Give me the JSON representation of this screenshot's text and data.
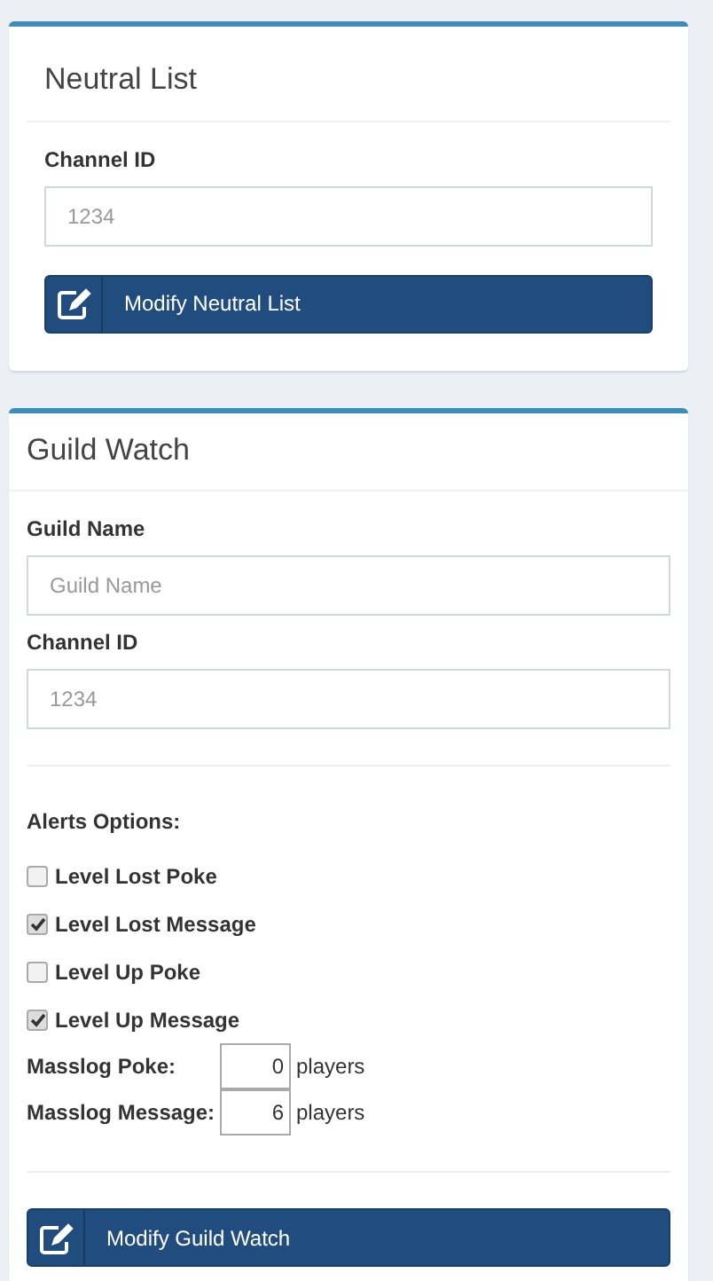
{
  "neutral_list": {
    "title": "Neutral List",
    "fields": [
      {
        "label": "Channel ID",
        "placeholder": "1234"
      }
    ],
    "button": "Modify Neutral List"
  },
  "guild_watch": {
    "title": "Guild Watch",
    "fields": [
      {
        "label": "Guild Name",
        "placeholder": "Guild Name"
      },
      {
        "label": "Channel ID",
        "placeholder": "1234"
      }
    ],
    "alerts_heading": "Alerts Options:",
    "options": [
      {
        "label": "Level Lost Poke",
        "checked": false
      },
      {
        "label": "Level Lost Message",
        "checked": true
      },
      {
        "label": "Level Up Poke",
        "checked": false
      },
      {
        "label": "Level Up Message",
        "checked": true
      }
    ],
    "thresholds": [
      {
        "label": "Masslog Poke:",
        "value": "0",
        "unit": "players"
      },
      {
        "label": "Masslog Message:",
        "value": "6",
        "unit": "players"
      }
    ],
    "button": "Modify Guild Watch"
  }
}
